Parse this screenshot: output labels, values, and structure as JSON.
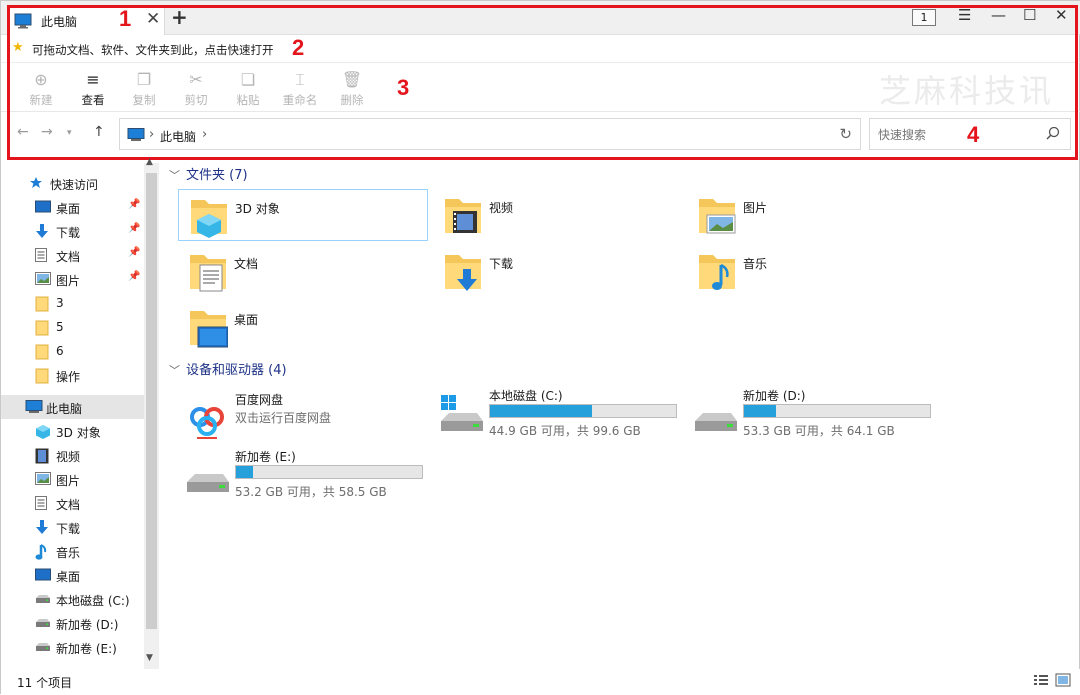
{
  "window": {
    "tab_title": "此电脑",
    "window_count": "1"
  },
  "quickbar": {
    "text": "可拖动文档、软件、文件夹到此，点击快速打开"
  },
  "toolbar": {
    "new_label": "新建",
    "view_label": "查看",
    "copy_label": "复制",
    "cut_label": "剪切",
    "paste_label": "粘贴",
    "rename_label": "重命名",
    "delete_label": "删除",
    "watermark": "芝麻科技讯"
  },
  "address": {
    "crumb": "此电脑"
  },
  "search": {
    "placeholder": "快速搜索"
  },
  "annotations": [
    "1",
    "2",
    "3",
    "4"
  ],
  "sidebar": {
    "items": [
      {
        "label": "快速访问",
        "icon": "star-icon"
      },
      {
        "label": "桌面",
        "icon": "desktop-icon"
      },
      {
        "label": "下载",
        "icon": "download-icon"
      },
      {
        "label": "文档",
        "icon": "document-icon"
      },
      {
        "label": "图片",
        "icon": "picture-icon"
      },
      {
        "label": "3",
        "icon": "folder-icon"
      },
      {
        "label": "5",
        "icon": "folder-icon"
      },
      {
        "label": "6",
        "icon": "folder-icon"
      },
      {
        "label": "操作",
        "icon": "folder-icon"
      },
      {
        "label": "此电脑",
        "icon": "computer-icon"
      },
      {
        "label": "3D 对象",
        "icon": "cube-icon"
      },
      {
        "label": "视频",
        "icon": "video-icon"
      },
      {
        "label": "图片",
        "icon": "picture-icon"
      },
      {
        "label": "文档",
        "icon": "document-icon"
      },
      {
        "label": "下载",
        "icon": "download-icon"
      },
      {
        "label": "音乐",
        "icon": "music-icon"
      },
      {
        "label": "桌面",
        "icon": "desktop-icon"
      },
      {
        "label": "本地磁盘 (C:)",
        "icon": "drive-icon"
      },
      {
        "label": "新加卷 (D:)",
        "icon": "drive-icon"
      },
      {
        "label": "新加卷 (E:)",
        "icon": "drive-icon"
      }
    ]
  },
  "main": {
    "folders_header": "文件夹 (7)",
    "folders": [
      {
        "label": "3D 对象"
      },
      {
        "label": "视频"
      },
      {
        "label": "图片"
      },
      {
        "label": "文档"
      },
      {
        "label": "下载"
      },
      {
        "label": "音乐"
      },
      {
        "label": "桌面"
      }
    ],
    "drives_header": "设备和驱动器 (4)",
    "drives": [
      {
        "name": "百度网盘",
        "sub": "双击运行百度网盘"
      },
      {
        "name": "本地磁盘 (C:)",
        "free": "44.9 GB 可用，共 99.6 GB",
        "used_fraction": 0.55
      },
      {
        "name": "新加卷 (D:)",
        "free": "53.3 GB 可用，共 64.1 GB",
        "used_fraction": 0.17
      },
      {
        "name": "新加卷 (E:)",
        "free": "53.2 GB 可用，共 58.5 GB",
        "used_fraction": 0.09
      }
    ]
  },
  "status": {
    "count": "11 个项目"
  },
  "colors": {
    "accent": "#26a0da",
    "annotation": "#e3141b",
    "group_header": "#1e3287"
  }
}
